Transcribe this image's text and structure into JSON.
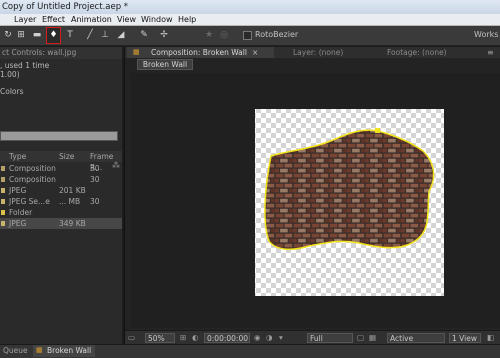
{
  "window": {
    "title": "Copy of Untitled Project.aep *"
  },
  "menu": [
    "Layer",
    "Effect",
    "Animation",
    "View",
    "Window",
    "Help"
  ],
  "toolbar": {
    "rotobezier_label": "RotoBezier",
    "workspace_label": "Works"
  },
  "project_panel": {
    "tab_label": "ct Controls: wall.jpg",
    "info_line1": ", used 1 time",
    "info_line2": "1.00)",
    "info_line3": "Colors",
    "columns": {
      "type": "Type",
      "size": "Size",
      "frame_rate": "Frame R..."
    },
    "rows": [
      {
        "type": "Composition",
        "size": "",
        "fr": "30",
        "color": "#b8a06a"
      },
      {
        "type": "Composition",
        "size": "",
        "fr": "30",
        "color": "#b8a06a"
      },
      {
        "type": "JPEG",
        "size": "201 KB",
        "fr": "",
        "color": "#c9b36a"
      },
      {
        "type": "JPEG Se...e",
        "size": "... MB",
        "fr": "30",
        "color": "#c9b36a"
      },
      {
        "type": "Folder",
        "size": "",
        "fr": "",
        "color": "#d8c34a"
      },
      {
        "type": "JPEG",
        "size": "349 KB",
        "fr": "",
        "color": "#c9b36a"
      }
    ]
  },
  "comp_panel": {
    "tabs": {
      "composition": "Composition: Broken Wall",
      "layer": "Layer: (none)",
      "footage": "Footage: (none)"
    },
    "sub_tab": "Broken Wall",
    "bottom": {
      "zoom": "50%",
      "timecode": "0:00:00:00",
      "resolution": "Full",
      "camera": "Active Camera",
      "views": "1 View"
    }
  },
  "statusbar": {
    "left": "Queue",
    "tab": "Broken Wall"
  },
  "colors": {
    "mask_stroke": "#f2e21a",
    "selected_tool_border": "#d61b1b"
  }
}
